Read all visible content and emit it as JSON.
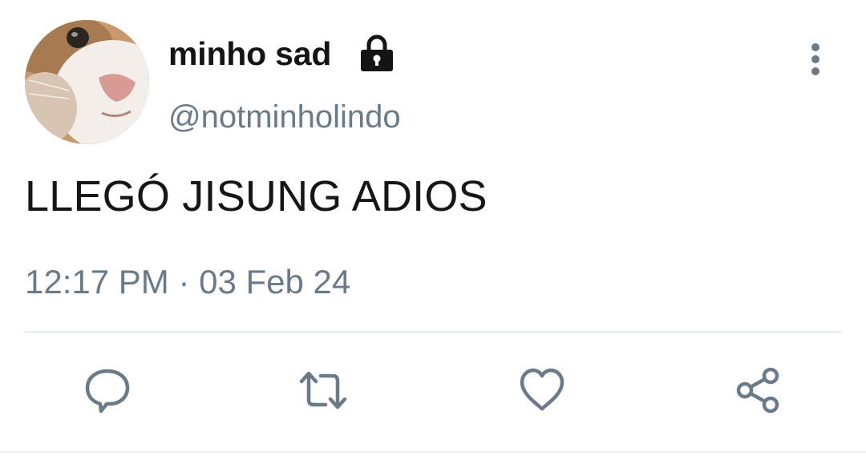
{
  "tweet": {
    "display_name": "minho sad",
    "handle": "@notminholindo",
    "text": "LLEGÓ JISUNG ADIOS",
    "timestamp": "12:17 PM · 03 Feb 24",
    "protected_icon": "lock-icon",
    "avatar_icon": "cat-avatar"
  },
  "actions": [
    {
      "icon": "reply-icon"
    },
    {
      "icon": "retweet-icon"
    },
    {
      "icon": "like-icon"
    },
    {
      "icon": "share-icon"
    }
  ],
  "more_icon": "more-vertical-icon",
  "colors": {
    "text": "#141414",
    "secondary": "#6b7a89",
    "divider": "#e6e9ec"
  }
}
